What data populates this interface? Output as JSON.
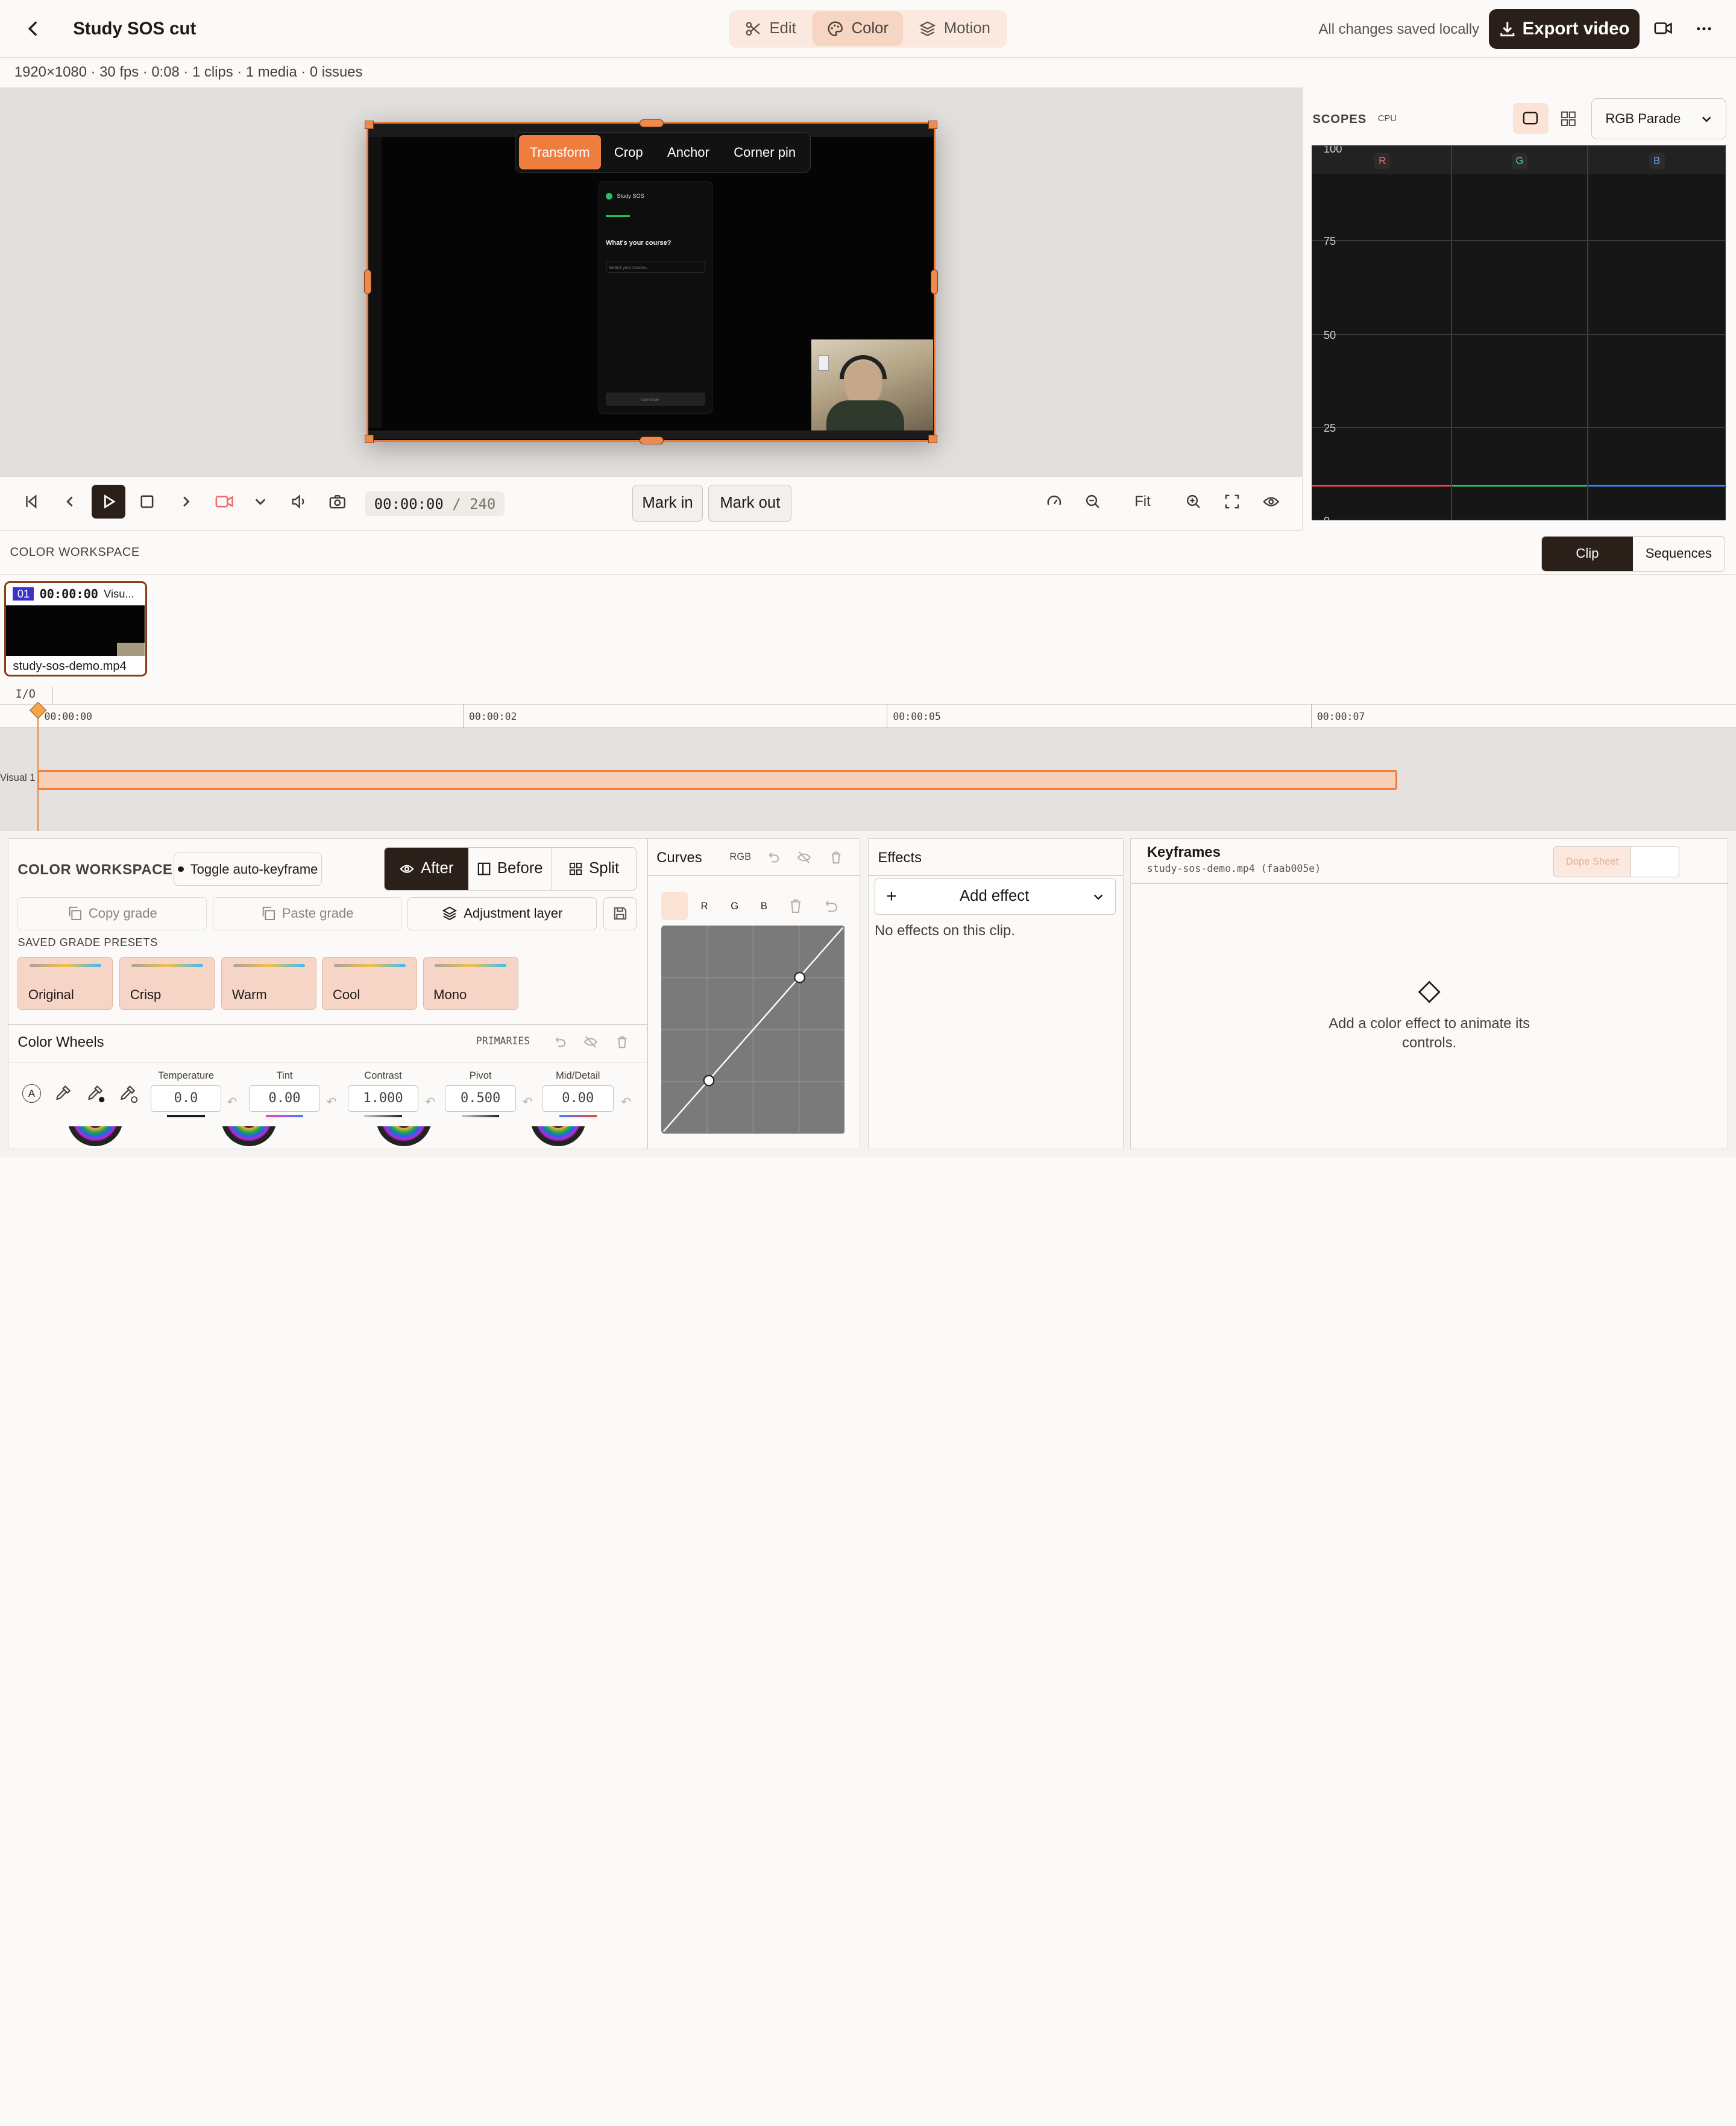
{
  "header": {
    "title": "Study SOS cut",
    "modes": [
      {
        "label": "Edit",
        "icon": "scissors-icon"
      },
      {
        "label": "Color",
        "icon": "palette-icon"
      },
      {
        "label": "Motion",
        "icon": "layers-icon"
      }
    ],
    "active_mode": "Color",
    "save_status": "All changes saved locally",
    "export_label": "Export video"
  },
  "info": {
    "summary": "1920×1080 · 30 fps · 0:08 · 1 clips · 1 media · 0 issues"
  },
  "preview": {
    "transform_tabs": [
      "Transform",
      "Crop",
      "Anchor",
      "Corner pin"
    ],
    "active_tab": "Transform"
  },
  "transport": {
    "timecode": "00:00:00",
    "total_frames": "/ 240",
    "mark_in": "Mark in",
    "mark_out": "Mark out",
    "fit_label": "Fit"
  },
  "scopes": {
    "title": "SCOPES",
    "badge": "CPU",
    "mode": "RGB Parade",
    "channels": [
      "R",
      "G",
      "B"
    ],
    "grid_labels": [
      "100",
      "75",
      "50",
      "25",
      "0"
    ],
    "channel_colors": {
      "r": "#ef4444",
      "g": "#22c55e",
      "b": "#3b82f6"
    }
  },
  "workspace": {
    "title": "COLOR WORKSPACE",
    "scope_tabs": [
      "Clip",
      "Sequences"
    ],
    "active_scope_tab": "Clip"
  },
  "clip": {
    "index": "01",
    "timecode": "00:00:00",
    "track": "Visu...",
    "filename": "study-sos-demo.mp4"
  },
  "timeline": {
    "io_label": "I/O",
    "ticks": [
      "00:00:00",
      "00:00:02",
      "00:00:05",
      "00:00:07"
    ],
    "track_label": "Visual 1"
  },
  "grade": {
    "title": "COLOR WORKSPACE",
    "auto_keyframe": "Toggle auto-keyframe",
    "view_modes": [
      "After",
      "Before",
      "Split"
    ],
    "active_view": "After",
    "copy_grade": "Copy grade",
    "paste_grade": "Paste grade",
    "adjustment_layer": "Adjustment layer",
    "presets_title": "SAVED GRADE PRESETS",
    "presets": [
      "Original",
      "Crisp",
      "Warm",
      "Cool",
      "Mono"
    ],
    "wheels_title": "Color Wheels",
    "wheels_mode": "PRIMARIES",
    "controls": [
      {
        "label": "Temperature",
        "value": "0.0"
      },
      {
        "label": "Tint",
        "value": "0.00"
      },
      {
        "label": "Contrast",
        "value": "1.000"
      },
      {
        "label": "Pivot",
        "value": "0.500"
      },
      {
        "label": "Mid/Detail",
        "value": "0.00"
      }
    ]
  },
  "curves": {
    "title": "Curves",
    "mode": "RGB",
    "channels": [
      "R",
      "G",
      "B"
    ]
  },
  "effects": {
    "title": "Effects",
    "add_label": "Add effect",
    "empty": "No effects on this clip."
  },
  "keyframes": {
    "title": "Keyframes",
    "subtitle": "study-sos-demo.mp4 (faab005e)",
    "tab_active": "Dope Sheet",
    "empty": "Add a color effect to animate its controls."
  },
  "webcam_frame": {
    "app_name": "Study SOS",
    "prompt": "What's your course?",
    "placeholder": "Select your course...",
    "button": "Continue"
  }
}
